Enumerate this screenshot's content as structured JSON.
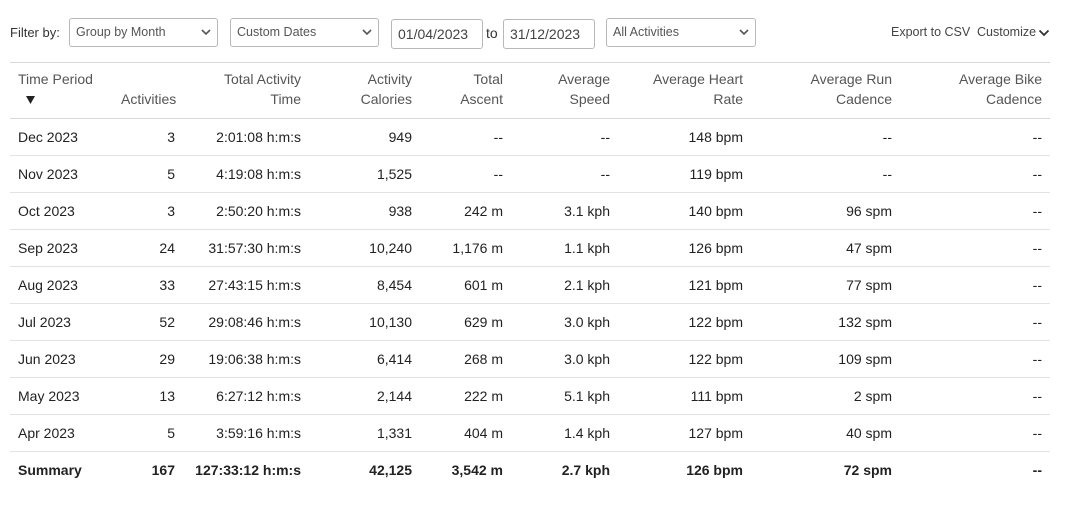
{
  "filters": {
    "label": "Filter by:",
    "group_by": "Group by Month",
    "date_mode": "Custom Dates",
    "start_date": "01/04/2023",
    "to_label": "to",
    "end_date": "31/12/2023",
    "activity_type": "All Activities"
  },
  "actions": {
    "export": "Export to CSV",
    "customize": "Customize"
  },
  "table": {
    "headers": [
      {
        "line1": "Time Period",
        "line2": ""
      },
      {
        "line1": "",
        "line2": "Activities"
      },
      {
        "line1": "Total Activity",
        "line2": "Time"
      },
      {
        "line1": "Activity",
        "line2": "Calories"
      },
      {
        "line1": "Total",
        "line2": "Ascent"
      },
      {
        "line1": "Average",
        "line2": "Speed"
      },
      {
        "line1": "Average Heart",
        "line2": "Rate"
      },
      {
        "line1": "Average Run",
        "line2": "Cadence"
      },
      {
        "line1": "Average Bike",
        "line2": "Cadence"
      }
    ],
    "rows": [
      [
        "Dec 2023",
        "3",
        "2:01:08 h:m:s",
        "949",
        "--",
        "--",
        "148 bpm",
        "--",
        "--"
      ],
      [
        "Nov 2023",
        "5",
        "4:19:08 h:m:s",
        "1,525",
        "--",
        "--",
        "119 bpm",
        "--",
        "--"
      ],
      [
        "Oct 2023",
        "3",
        "2:50:20 h:m:s",
        "938",
        "242 m",
        "3.1 kph",
        "140 bpm",
        "96 spm",
        "--"
      ],
      [
        "Sep 2023",
        "24",
        "31:57:30 h:m:s",
        "10,240",
        "1,176 m",
        "1.1 kph",
        "126 bpm",
        "47 spm",
        "--"
      ],
      [
        "Aug 2023",
        "33",
        "27:43:15 h:m:s",
        "8,454",
        "601 m",
        "2.1 kph",
        "121 bpm",
        "77 spm",
        "--"
      ],
      [
        "Jul 2023",
        "52",
        "29:08:46 h:m:s",
        "10,130",
        "629 m",
        "3.0 kph",
        "122 bpm",
        "132 spm",
        "--"
      ],
      [
        "Jun 2023",
        "29",
        "19:06:38 h:m:s",
        "6,414",
        "268 m",
        "3.0 kph",
        "122 bpm",
        "109 spm",
        "--"
      ],
      [
        "May 2023",
        "13",
        "6:27:12 h:m:s",
        "2,144",
        "222 m",
        "5.1 kph",
        "111 bpm",
        "2 spm",
        "--"
      ],
      [
        "Apr 2023",
        "5",
        "3:59:16 h:m:s",
        "1,331",
        "404 m",
        "1.4 kph",
        "127 bpm",
        "40 spm",
        "--"
      ]
    ],
    "summary": [
      "Summary",
      "167",
      "127:33:12 h:m:s",
      "42,125",
      "3,542 m",
      "2.7 kph",
      "126 bpm",
      "72 spm",
      "--"
    ]
  },
  "icons": {
    "select_chevron": "chevron-down-icon",
    "sort": "sort-desc-icon"
  }
}
